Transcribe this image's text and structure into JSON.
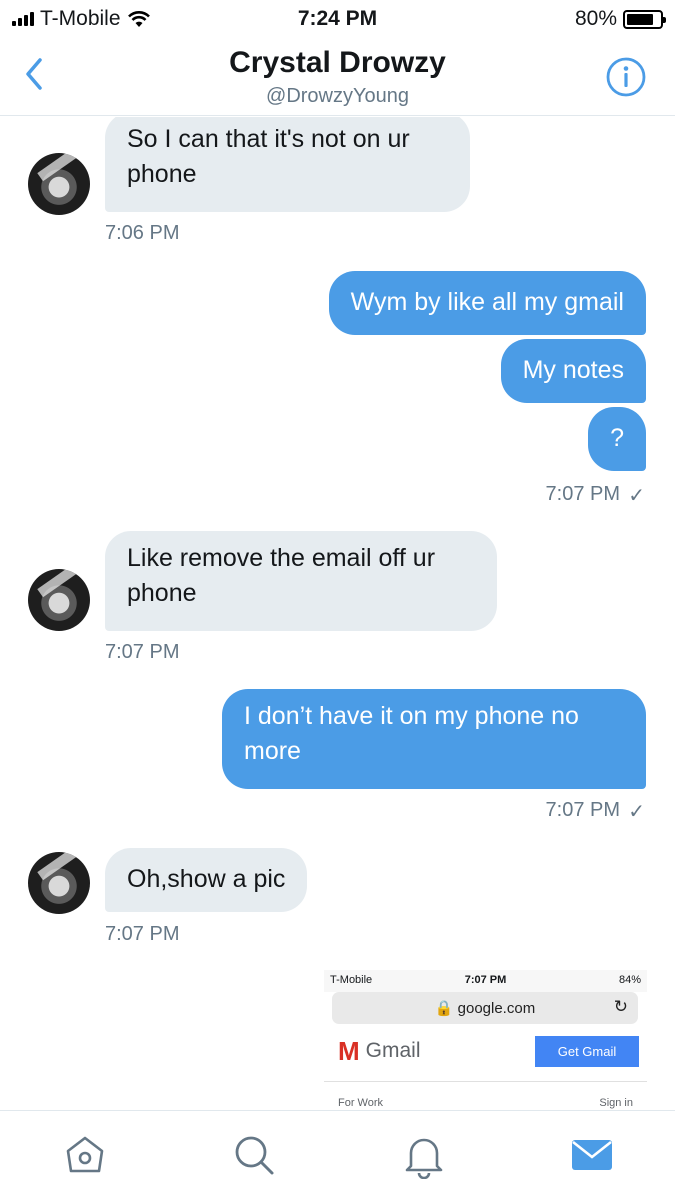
{
  "status_bar": {
    "carrier": "T-Mobile",
    "time": "7:24 PM",
    "battery": "80%",
    "battery_level": 0.8
  },
  "header": {
    "name": "Crystal Drowzy",
    "handle": "@DrowzyYoung",
    "back_icon": "chevron-left-icon",
    "info_icon": "info-icon"
  },
  "messages": [
    {
      "dir": "in",
      "text": "So I can that it's not on ur phone"
    },
    {
      "dir": "in",
      "time": "7:06 PM"
    },
    {
      "dir": "out",
      "text": "Wym by like all my gmail"
    },
    {
      "dir": "out",
      "text": "My notes"
    },
    {
      "dir": "out",
      "text": "?"
    },
    {
      "dir": "out",
      "time": "7:07 PM",
      "check": "✓"
    },
    {
      "dir": "in",
      "text": "Like remove the email off ur phone"
    },
    {
      "dir": "in",
      "time": "7:07 PM"
    },
    {
      "dir": "out",
      "text": "I don’t have it on my phone no more"
    },
    {
      "dir": "out",
      "time": "7:07 PM",
      "check": "✓"
    },
    {
      "dir": "in",
      "text": "Oh,show a pic"
    },
    {
      "dir": "in",
      "time": "7:07 PM"
    }
  ],
  "image": {
    "carrier": "T-Mobile",
    "time": "7:07 PM",
    "battery": "84%",
    "url": "google.com",
    "brand": "Gmail",
    "button": "Get Gmail",
    "for_work": "For Work",
    "sign_in": "Sign in"
  },
  "tabs": [
    "home-icon",
    "search-icon",
    "bell-icon",
    "mail-icon"
  ],
  "colors": {
    "accent": "#4b9ce6",
    "incoming": "#e6ecf0",
    "secondary_text": "#657786"
  }
}
